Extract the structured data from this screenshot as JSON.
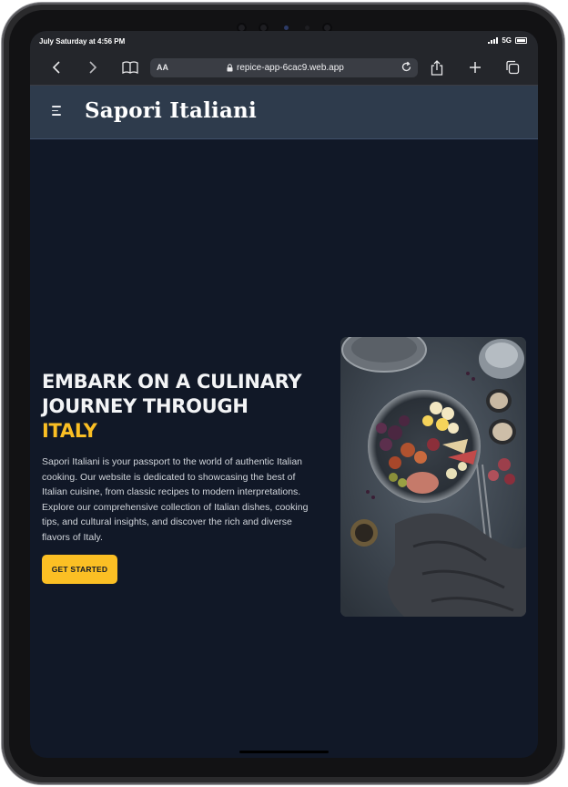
{
  "status_bar": {
    "time": "July Saturday at 4:56 PM",
    "network": "5G"
  },
  "browser": {
    "text_size_label": "AA",
    "url": "repice-app-6cac9.web.app",
    "icons": [
      "back-icon",
      "forward-icon",
      "bookmarks-icon",
      "lock-icon",
      "reload-icon",
      "share-icon",
      "new-tab-icon",
      "tabs-icon"
    ]
  },
  "navbar": {
    "brand": "Sapori Italiani",
    "menu_icon": "hamburger-menu-icon"
  },
  "hero": {
    "title_line": "EMBARK ON A CULINARY JOURNEY THROUGH",
    "title_accent": "ITALY",
    "description": "Sapori Italiani is your passport to the world of authentic Italian cooking. Our website is dedicated to showcasing the best of Italian cuisine, from classic recipes to modern interpretations. Explore our comprehensive collection of Italian dishes, cooking tips, and cultural insights, and discover the rich and diverse flavors of Italy.",
    "cta_label": "GET STARTED",
    "image": "italian-food-platter-image"
  },
  "colors": {
    "background": "#111827",
    "navbar": "#2e3b4c",
    "accent": "#fbbf24",
    "text": "#f3f4f6"
  }
}
